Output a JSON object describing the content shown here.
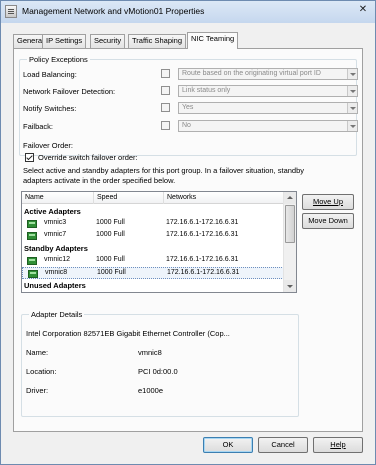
{
  "window": {
    "title": "Management Network and vMotion01 Properties",
    "close_glyph": "✕"
  },
  "tabs": [
    {
      "label": "General"
    },
    {
      "label": "IP Settings"
    },
    {
      "label": "Security"
    },
    {
      "label": "Traffic Shaping"
    },
    {
      "label": "NIC Teaming",
      "active": true
    }
  ],
  "policy": {
    "title": "Policy Exceptions",
    "rows": [
      {
        "label": "Load Balancing:",
        "value": "Route based on the originating virtual port ID"
      },
      {
        "label": "Network Failover Detection:",
        "value": "Link status only"
      },
      {
        "label": "Notify Switches:",
        "value": "Yes"
      },
      {
        "label": "Failback:",
        "value": "No"
      }
    ]
  },
  "failover": {
    "title": "Failover Order:",
    "override_label": "Override switch failover order:",
    "override_checked": true,
    "instructions": [
      "Select active and standby adapters for this port group.  In a failover situation, standby",
      "adapters activate  in the order specified below."
    ]
  },
  "adapter_list": {
    "columns": [
      "Name",
      "Speed",
      "Networks"
    ],
    "groups": {
      "active": "Active Adapters",
      "standby": "Standby Adapters",
      "unused": "Unused Adapters"
    },
    "active": [
      {
        "name": "vmnic3",
        "speed": "1000 Full",
        "networks": "172.16.6.1-172.16.6.31"
      },
      {
        "name": "vmnic7",
        "speed": "1000 Full",
        "networks": "172.16.6.1-172.16.6.31"
      }
    ],
    "standby": [
      {
        "name": "vmnic12",
        "speed": "1000 Full",
        "networks": "172.16.6.1-172.16.6.31"
      },
      {
        "name": "vmnic8",
        "speed": "1000 Full",
        "networks": "172.16.6.1-172.16.6.31",
        "selected": true
      }
    ]
  },
  "buttons": {
    "move_up": "Move Up",
    "move_down": "Move Down",
    "ok": "OK",
    "cancel": "Cancel",
    "help": "Help"
  },
  "details": {
    "title": "Adapter Details",
    "description": "Intel Corporation 82571EB Gigabit Ethernet Controller (Cop...",
    "fields": [
      {
        "label": "Name:",
        "value": "vmnic8"
      },
      {
        "label": "Location:",
        "value": "PCI 0d:00.0"
      },
      {
        "label": "Driver:",
        "value": "e1000e"
      }
    ]
  }
}
